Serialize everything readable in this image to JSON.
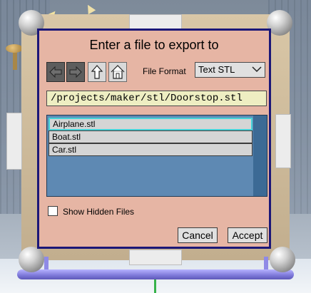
{
  "dialog": {
    "title": "Enter a file to export to",
    "file_format_label": "File Format",
    "file_format_value": "Text STL",
    "path_value": "/projects/maker/stl/Doorstop.stl",
    "files": [
      "Airplane.stl",
      "Boat.stl",
      "Car.stl"
    ],
    "selected_file": "Airplane.stl",
    "show_hidden_label": "Show Hidden Files",
    "show_hidden_checked": false,
    "cancel_label": "Cancel",
    "accept_label": "Accept"
  },
  "icons": {
    "back": "arrow-left-icon",
    "forward": "arrow-right-icon",
    "up": "arrow-up-icon",
    "home": "home-icon",
    "dropdown": "chevron-down-icon"
  },
  "colors": {
    "dialog_bg": "#e6b5a4",
    "dialog_border": "#1b1778",
    "path_bg": "#eeeec2",
    "list_bg": "#5e89b3",
    "selection_outline": "#45d2d8"
  }
}
